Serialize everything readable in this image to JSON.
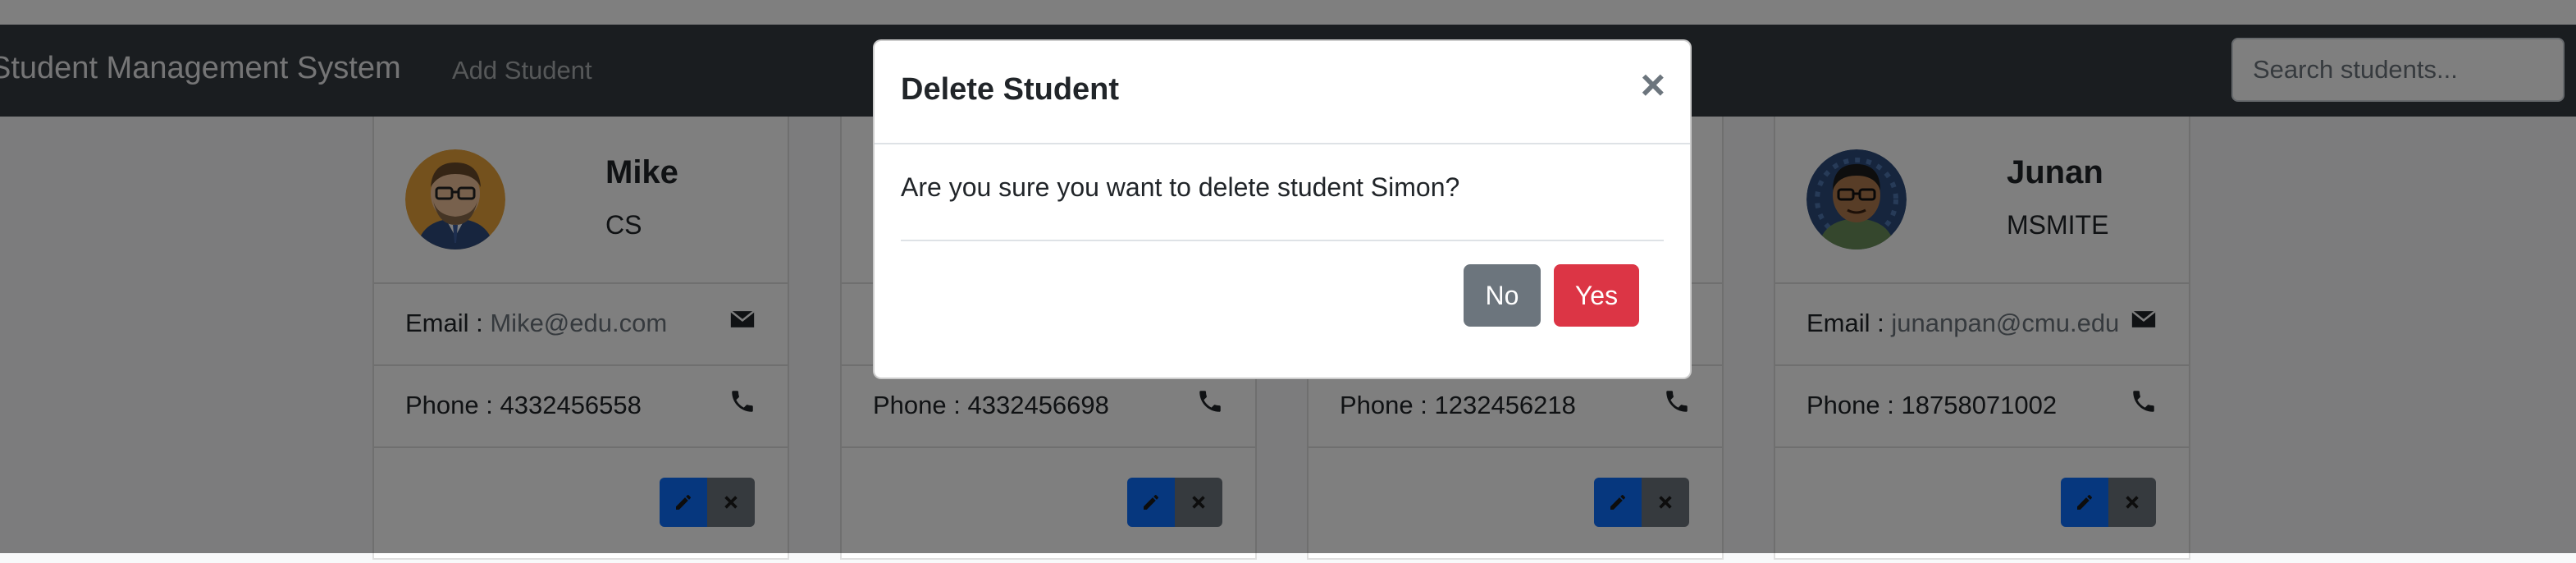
{
  "navbar": {
    "brand": "Student Management System",
    "add_link": "Add Student",
    "search_placeholder": "Search students..."
  },
  "cards": [
    {
      "name": "Mike",
      "major": "CS",
      "email_label": "Email : ",
      "email": "Mike@edu.com",
      "phone_label": "Phone : ",
      "phone": "4332456558",
      "avatar_icon": "avatar-man-glasses"
    },
    {
      "name": "",
      "major": "",
      "email_label": "",
      "email": "",
      "phone_label": "Phone : ",
      "phone": "4332456698",
      "avatar_icon": "avatar"
    },
    {
      "name": "",
      "major": "",
      "email_label": "",
      "email": "",
      "phone_label": "Phone : ",
      "phone": "1232456218",
      "avatar_icon": "avatar"
    },
    {
      "name": "Junan",
      "major": "MSMITE",
      "email_label": "Email : ",
      "email": "junanpan@cmu.edu",
      "phone_label": "Phone : ",
      "phone": "18758071002",
      "avatar_icon": "avatar-man-glasses-green-shirt"
    }
  ],
  "icons": {
    "email": "envelope-icon",
    "phone": "phone-icon",
    "edit": "pencil-icon",
    "delete": "close-icon"
  },
  "modal": {
    "title": "Delete Student",
    "close_glyph": "×",
    "message": "Are you sure you want to delete student Simon?",
    "no_label": "No",
    "yes_label": "Yes"
  },
  "colors": {
    "navbar": "#343a40",
    "edit_button": "#0d6efd",
    "delete_button": "#6c757d",
    "no_button": "#6c757d",
    "yes_button": "#dc3545"
  }
}
